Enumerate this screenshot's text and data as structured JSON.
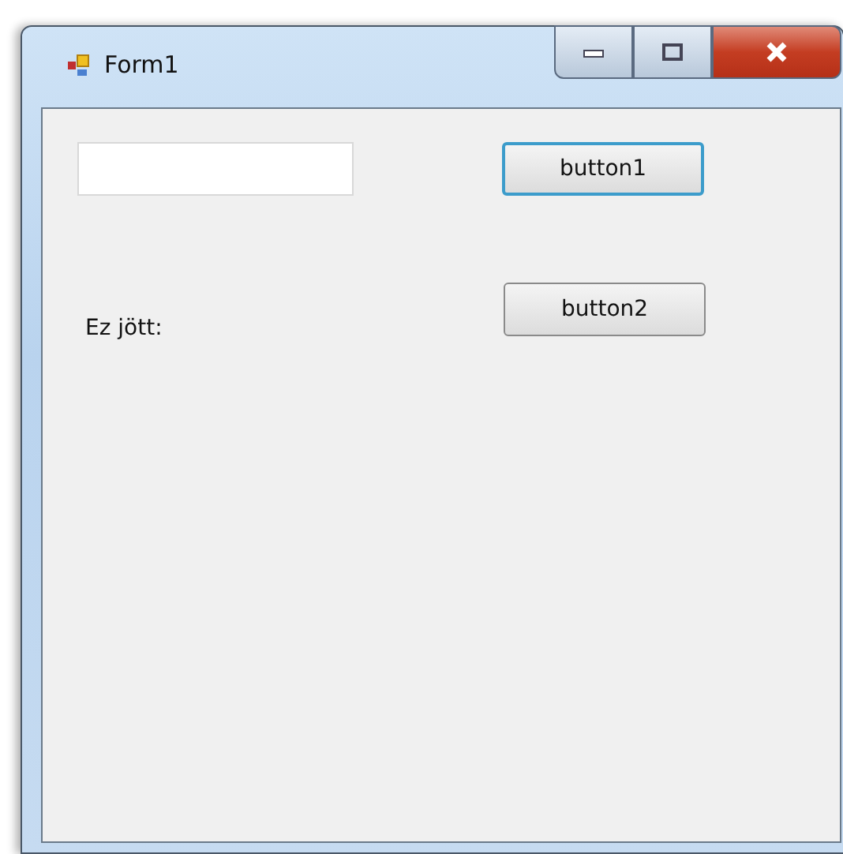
{
  "window": {
    "title": "Form1"
  },
  "text_field": {
    "kind": "textbox"
  },
  "buttons": [
    {
      "label": "button1",
      "focused": true
    },
    {
      "label": "button2",
      "focused": false
    }
  ],
  "label": "Ez jött:"
}
